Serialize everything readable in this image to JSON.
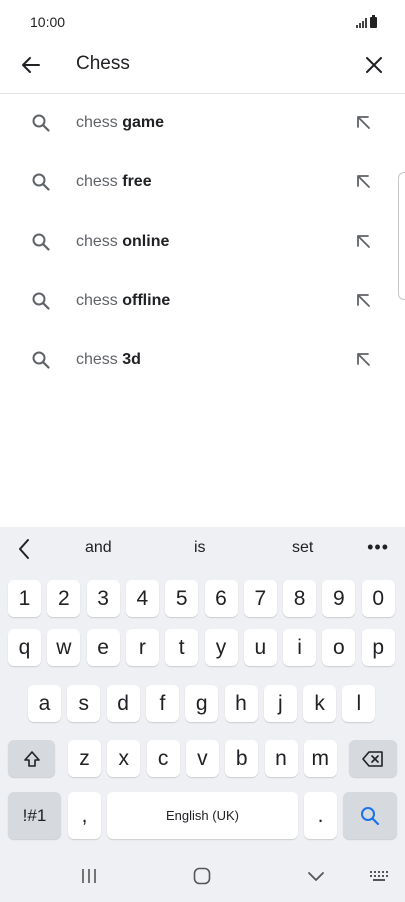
{
  "status_bar": {
    "time": "10:00"
  },
  "search": {
    "query": "Chess",
    "back_icon": "arrow-left-icon",
    "clear_icon": "close-icon"
  },
  "suggestions": [
    {
      "prefix": "chess",
      "completion": "game"
    },
    {
      "prefix": "chess",
      "completion": "free"
    },
    {
      "prefix": "chess",
      "completion": "online"
    },
    {
      "prefix": "chess",
      "completion": "offline"
    },
    {
      "prefix": "chess",
      "completion": "3d"
    }
  ],
  "keyboard": {
    "predictions": [
      "and",
      "is",
      "set"
    ],
    "more_label": "•••",
    "number_row": [
      "1",
      "2",
      "3",
      "4",
      "5",
      "6",
      "7",
      "8",
      "9",
      "0"
    ],
    "row1": [
      "q",
      "w",
      "e",
      "r",
      "t",
      "y",
      "u",
      "i",
      "o",
      "p"
    ],
    "row2": [
      "a",
      "s",
      "d",
      "f",
      "g",
      "h",
      "j",
      "k",
      "l"
    ],
    "row3": [
      "z",
      "x",
      "c",
      "v",
      "b",
      "n",
      "m"
    ],
    "symbols_label": "!#1",
    "comma_label": ",",
    "space_label": "English (UK)",
    "period_label": ".",
    "accent_color": "#1a73e8"
  }
}
